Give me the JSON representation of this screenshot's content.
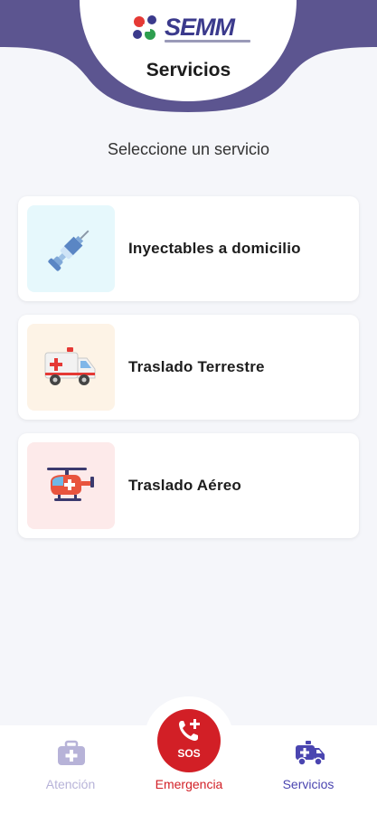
{
  "header": {
    "logo_text": "SEMM",
    "title": "Servicios"
  },
  "main": {
    "subtitle": "Seleccione un servicio",
    "services": [
      {
        "label": "Inyectables a domicilio",
        "icon": "syringe-icon",
        "bg": "#e6f8fc"
      },
      {
        "label": "Traslado Terrestre",
        "icon": "ambulance-icon",
        "bg": "#fdf3e6"
      },
      {
        "label": "Traslado Aéreo",
        "icon": "helicopter-icon",
        "bg": "#fdeaea"
      }
    ]
  },
  "bottom_nav": {
    "items": [
      {
        "label": "Atención",
        "icon": "medical-kit-icon",
        "color": "#b7b3d8"
      },
      {
        "label": "Emergencia",
        "icon": "phone-plus-icon",
        "color": "#d21f26"
      },
      {
        "label": "Servicios",
        "icon": "ambulance-icon",
        "color": "#4a45b0"
      }
    ],
    "sos_label": "SOS"
  },
  "colors": {
    "brand": "#5c5590",
    "emergency": "#d21f26",
    "active": "#4a45b0"
  }
}
